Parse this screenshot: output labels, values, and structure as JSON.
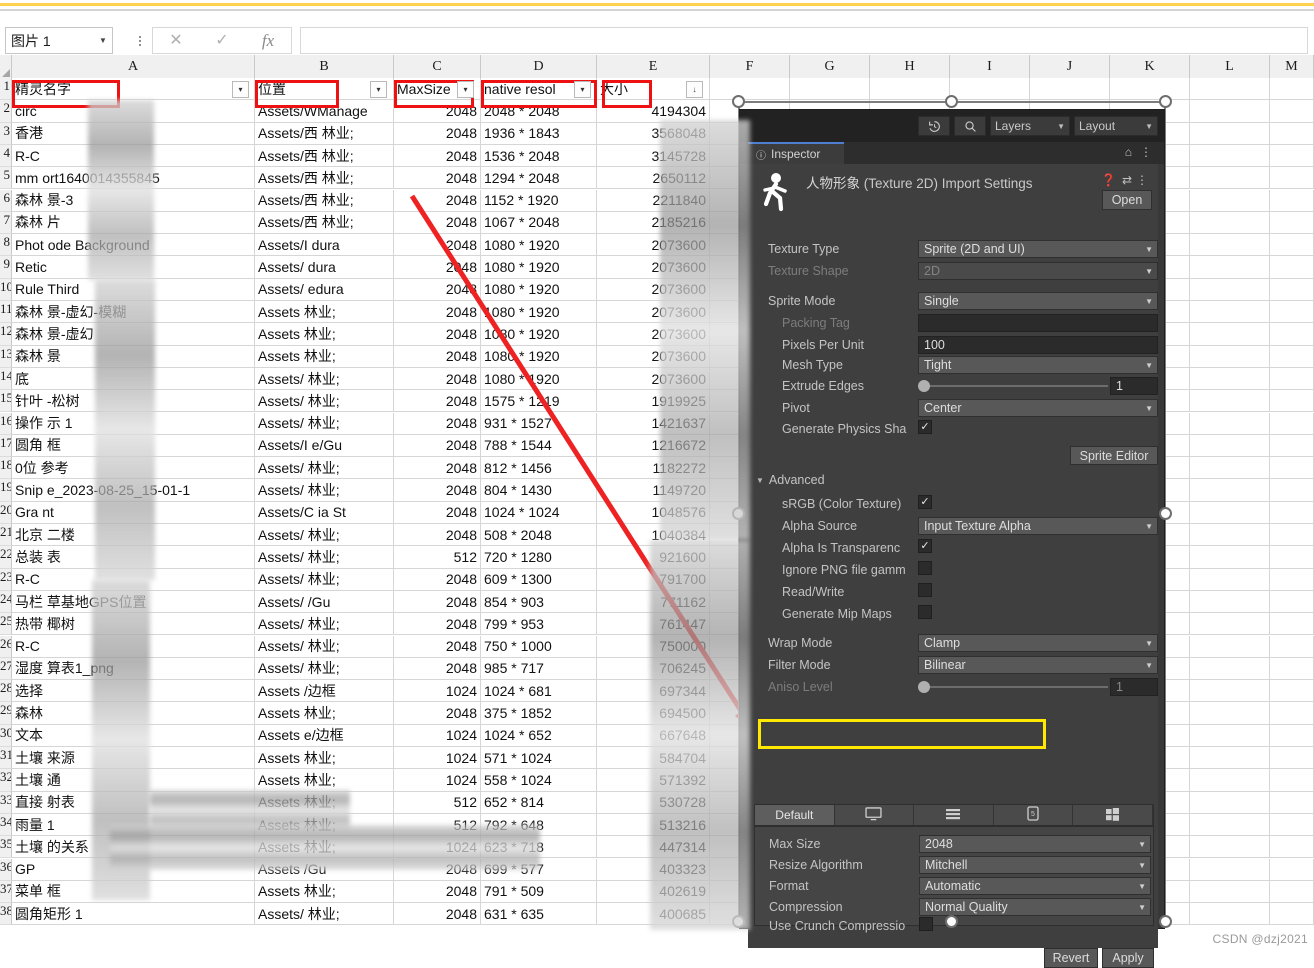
{
  "app": {
    "name_box_value": "图片 1",
    "formula_value": "",
    "cancel_icon": "close-icon",
    "confirm_icon": "check-icon",
    "function_icon": "fx-icon",
    "watermark": "CSDN @dzj2021"
  },
  "sheet": {
    "column_letters": [
      "A",
      "B",
      "C",
      "D",
      "E",
      "F",
      "G",
      "H",
      "I",
      "J",
      "K",
      "L",
      "M"
    ],
    "headers": [
      "精灵名字",
      "位置",
      "MaxSize",
      "native resol",
      "大小"
    ],
    "filter_arrow_glyph": "▾",
    "sort_arrow_glyph": "↓",
    "rows": [
      {
        "n": "2",
        "a": "circ",
        "b": "Assets/WManage",
        "c": "2048",
        "d": "2048 * 2048",
        "e": "4194304"
      },
      {
        "n": "3",
        "a": "香港",
        "b": "Assets/西     林业;",
        "c": "2048",
        "d": "1936 * 1843",
        "e": "3568048"
      },
      {
        "n": "4",
        "a": "R-C",
        "b": "Assets/西     林业;",
        "c": "2048",
        "d": "1536 * 2048",
        "e": "3145728"
      },
      {
        "n": "5",
        "a": "mm      ort1640014355845",
        "b": "Assets/西     林业;",
        "c": "2048",
        "d": "1294 * 2048",
        "e": "2650112"
      },
      {
        "n": "6",
        "a": "森林    景-3",
        "b": "Assets/西     林业;",
        "c": "2048",
        "d": "1152 * 1920",
        "e": "2211840"
      },
      {
        "n": "7",
        "a": "森林    片",
        "b": "Assets/西     林业;",
        "c": "2048",
        "d": "1067 * 2048",
        "e": "2185216"
      },
      {
        "n": "8",
        "a": "Phot    ode Background",
        "b": "Assets/I     dura",
        "c": "2048",
        "d": "1080 * 1920",
        "e": "2073600"
      },
      {
        "n": "9",
        "a": "Retic",
        "b": "Assets/      dura",
        "c": "2048",
        "d": "1080 * 1920",
        "e": "2073600"
      },
      {
        "n": "10",
        "a": "Rule    Third",
        "b": "Assets/      edura",
        "c": "2048",
        "d": "1080 * 1920",
        "e": "2073600"
      },
      {
        "n": "11",
        "a": "森林  景-虚幻-模糊",
        "b": "Assets      林业;",
        "c": "2048",
        "d": "1080 * 1920",
        "e": "2073600"
      },
      {
        "n": "12",
        "a": "森林  景-虚幻",
        "b": "Assets      林业;",
        "c": "2048",
        "d": "1080 * 1920",
        "e": "2073600"
      },
      {
        "n": "13",
        "a": "森林  景",
        "b": "Assets      林业;",
        "c": "2048",
        "d": "1080 * 1920",
        "e": "2073600"
      },
      {
        "n": "14",
        "a": "底",
        "b": "Assets/     林业;",
        "c": "2048",
        "d": "1080 * 1920",
        "e": "2073600"
      },
      {
        "n": "15",
        "a": "针叶    -松树",
        "b": "Assets/     林业;",
        "c": "2048",
        "d": "1575 * 1219",
        "e": "1919925"
      },
      {
        "n": "16",
        "a": "操作    示 1",
        "b": "Assets/     林业;",
        "c": "2048",
        "d": "931 * 1527",
        "e": "1421637"
      },
      {
        "n": "17",
        "a": "圆角    框",
        "b": "Assets/I    e/Gu",
        "c": "2048",
        "d": "788 * 1544",
        "e": "1216672"
      },
      {
        "n": "18",
        "a": "0位    参考",
        "b": "Assets/     林业;",
        "c": "2048",
        "d": "812 * 1456",
        "e": "1182272"
      },
      {
        "n": "19",
        "a": "Snip    e_2023-08-25_15-01-1",
        "b": "Assets/     林业;",
        "c": "2048",
        "d": "804 * 1430",
        "e": "1149720"
      },
      {
        "n": "20",
        "a": "Gra     nt",
        "b": "Assets/C    ia St",
        "c": "2048",
        "d": "1024 * 1024",
        "e": "1048576"
      },
      {
        "n": "21",
        "a": "北京    二楼",
        "b": "Assets/     林业;",
        "c": "2048",
        "d": "508 * 2048",
        "e": "1040384"
      },
      {
        "n": "22",
        "a": "总装    表",
        "b": "Assets/     林业;",
        "c": "512",
        "d": "720 * 1280",
        "e": "921600"
      },
      {
        "n": "23",
        "a": "R-C",
        "b": "Assets/     林业;",
        "c": "2048",
        "d": "609 * 1300",
        "e": "791700"
      },
      {
        "n": "24",
        "a": "马栏    草基地GPS位置",
        "b": "Assets/     /Gu",
        "c": "2048",
        "d": "854 * 903",
        "e": "771162"
      },
      {
        "n": "25",
        "a": "热带    椰树",
        "b": "Assets/     林业;",
        "c": "2048",
        "d": "799 * 953",
        "e": "761447"
      },
      {
        "n": "26",
        "a": "R-C",
        "b": "Assets/     林业;",
        "c": "2048",
        "d": "750 * 1000",
        "e": "750000"
      },
      {
        "n": "27",
        "a": "湿度    算表1_png",
        "b": "Assets/     林业;",
        "c": "2048",
        "d": "985 * 717",
        "e": "706245"
      },
      {
        "n": "28",
        "a": "选择",
        "b": "Assets      /边框",
        "c": "1024",
        "d": "1024 * 681",
        "e": "697344"
      },
      {
        "n": "29",
        "a": "森林",
        "b": "Assets      林业;",
        "c": "2048",
        "d": "375 * 1852",
        "e": "694500"
      },
      {
        "n": "30",
        "a": "文本",
        "b": "Assets     e/边框",
        "c": "1024",
        "d": "1024 * 652",
        "e": "667648"
      },
      {
        "n": "31",
        "a": "土壤    来源",
        "b": "Assets      林业;",
        "c": "1024",
        "d": "571 * 1024",
        "e": "584704"
      },
      {
        "n": "32",
        "a": "土壤    通",
        "b": "Assets      林业;",
        "c": "1024",
        "d": "558 * 1024",
        "e": "571392"
      },
      {
        "n": "33",
        "a": "直接    射表",
        "b": "Assets      林业;",
        "c": "512",
        "d": "652 * 814",
        "e": "530728"
      },
      {
        "n": "34",
        "a": "雨量    1",
        "b": "Assets      林业;",
        "c": "512",
        "d": "792 * 648",
        "e": "513216"
      },
      {
        "n": "35",
        "a": "土壤            的关系",
        "b": "Assets      林业;",
        "c": "1024",
        "d": "623 * 718",
        "e": "447314"
      },
      {
        "n": "36",
        "a": "GP",
        "b": "Assets      /Gu",
        "c": "2048",
        "d": "699 * 577",
        "e": "403323"
      },
      {
        "n": "37",
        "a": "菜单    框",
        "b": "Assets      林业;",
        "c": "2048",
        "d": "791 * 509",
        "e": "402619"
      },
      {
        "n": "38",
        "a": "圆角矩形 1",
        "b": "Assets/     林业;",
        "c": "2048",
        "d": "631 * 635",
        "e": "400685"
      }
    ]
  },
  "unity": {
    "toolbar": {
      "history_icon": "history-icon",
      "search_icon": "search-icon",
      "layers_label": "Layers",
      "layout_label": "Layout",
      "caret_glyph": "▼"
    },
    "tab": {
      "label": "Inspector",
      "info_icon": "info-icon",
      "lock_icon": "lock-icon",
      "menu_icon": "kebab-menu-icon"
    },
    "header": {
      "asset_name": "人物形象",
      "title_suffix": " (Texture 2D) Import Settings",
      "avatar_icon": "walking-person-icon",
      "help_icon": "help-icon",
      "preset_icon": "preset-icon",
      "menu_icon": "kebab-menu-icon",
      "open_button": "Open"
    },
    "properties": [
      {
        "label": "Texture Type",
        "value": "Sprite (2D and UI)",
        "kind": "dropdown"
      },
      {
        "label": "Texture Shape",
        "value": "2D",
        "kind": "dropdown-disabled"
      },
      {
        "label": "Sprite Mode",
        "value": "Single",
        "kind": "dropdown"
      },
      {
        "label": "Packing Tag",
        "value": "",
        "kind": "text-disabled"
      },
      {
        "label": "Pixels Per Unit",
        "value": "100",
        "kind": "text"
      },
      {
        "label": "Mesh Type",
        "value": "Tight",
        "kind": "dropdown"
      },
      {
        "label": "Extrude Edges",
        "value": "1",
        "kind": "slider"
      },
      {
        "label": "Pivot",
        "value": "Center",
        "kind": "dropdown"
      },
      {
        "label": "Generate Physics Sha",
        "value": "checked",
        "kind": "checkbox"
      }
    ],
    "sprite_editor_button": "Sprite Editor",
    "advanced": {
      "label": "Advanced",
      "triangle": "▼",
      "items": [
        {
          "label": "sRGB (Color Texture)",
          "value": "checked",
          "kind": "checkbox"
        },
        {
          "label": "Alpha Source",
          "value": "Input Texture Alpha",
          "kind": "dropdown"
        },
        {
          "label": "Alpha Is Transparenc",
          "value": "checked",
          "kind": "checkbox"
        },
        {
          "label": "Ignore PNG file gamm",
          "value": "unchecked",
          "kind": "checkbox"
        },
        {
          "label": "Read/Write",
          "value": "unchecked",
          "kind": "checkbox"
        },
        {
          "label": "Generate Mip Maps",
          "value": "unchecked",
          "kind": "checkbox"
        }
      ]
    },
    "wrap": [
      {
        "label": "Wrap Mode",
        "value": "Clamp",
        "kind": "dropdown"
      },
      {
        "label": "Filter Mode",
        "value": "Bilinear",
        "kind": "dropdown"
      },
      {
        "label": "Aniso Level",
        "value": "1",
        "kind": "slider-disabled"
      }
    ],
    "platform": {
      "tabs": [
        {
          "label": "Default",
          "icon": ""
        },
        {
          "label": "",
          "icon": "standalone-icon"
        },
        {
          "label": "",
          "icon": "android-icon"
        },
        {
          "label": "",
          "icon": "ios-icon"
        },
        {
          "label": "",
          "icon": "windows-icon"
        }
      ],
      "settings": [
        {
          "label": "Max Size",
          "value": "2048",
          "kind": "dropdown-highlighted"
        },
        {
          "label": "Resize Algorithm",
          "value": "Mitchell",
          "kind": "dropdown"
        },
        {
          "label": "Format",
          "value": "Automatic",
          "kind": "dropdown"
        },
        {
          "label": "Compression",
          "value": "Normal Quality",
          "kind": "dropdown"
        },
        {
          "label": "Use Crunch Compressio",
          "value": "unchecked",
          "kind": "checkbox"
        }
      ]
    },
    "footer": {
      "revert": "Revert",
      "apply": "Apply"
    }
  },
  "annotations": {
    "highlight_color": "#ee1111",
    "maxsize_highlight_color": "#ffe900",
    "arrow_color": "#ee2222"
  }
}
